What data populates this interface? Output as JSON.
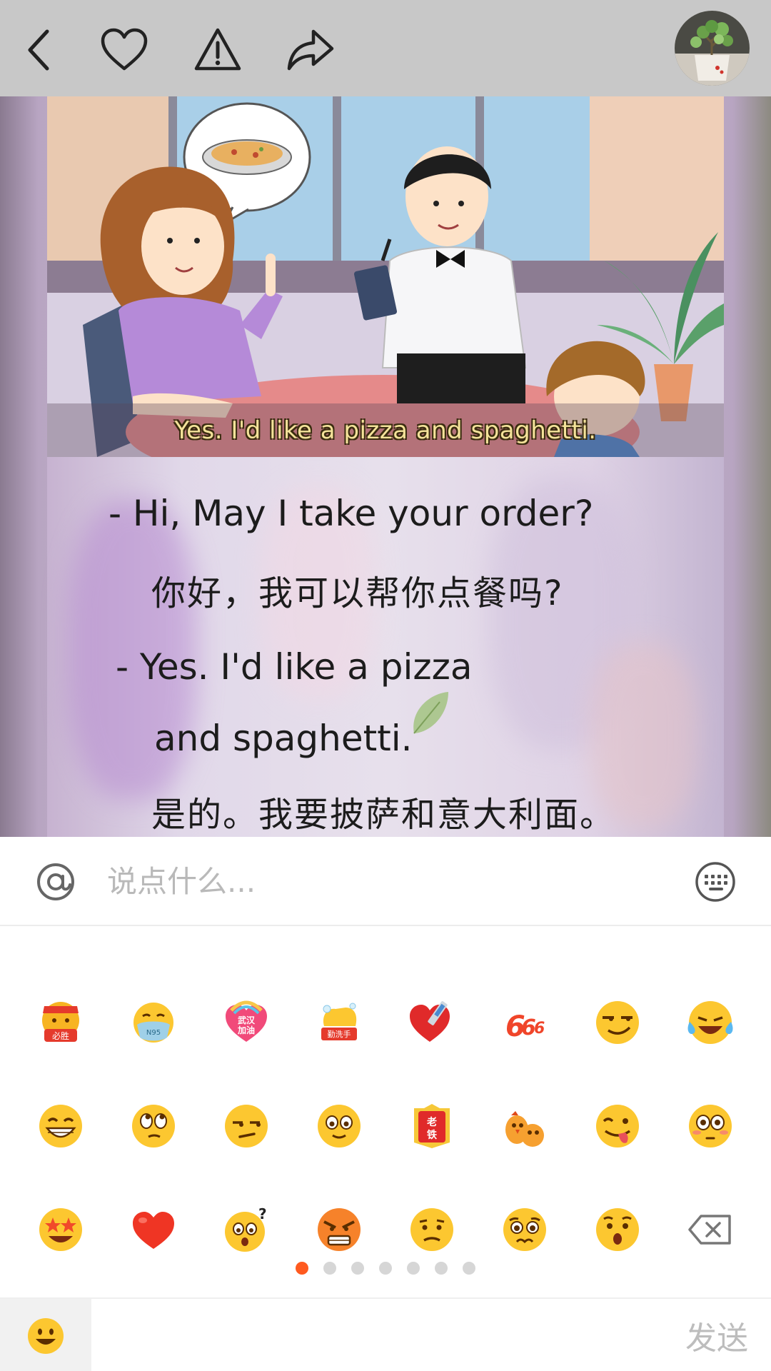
{
  "topbar": {
    "back_icon": "chevron-left-icon",
    "like_icon": "heart-outline-icon",
    "report_icon": "warning-triangle-icon",
    "share_icon": "share-arrow-icon",
    "avatar": "user-avatar-plant"
  },
  "media": {
    "subtitle": "Yes. I'd like a pizza and spaghetti.",
    "lines": [
      "- Hi, May I take your order?",
      "你好，我可以帮你点餐吗?",
      "- Yes. I'd like a pizza",
      "and spaghetti.",
      "是的。我要披萨和意大利面。"
    ]
  },
  "comment": {
    "placeholder": "说点什么...",
    "at_icon": "at-mention-icon",
    "keyboard_icon": "keyboard-icon"
  },
  "emoji_panel": {
    "rows": [
      [
        "bisheng-emoji",
        "mask-n95-emoji",
        "wuhan-jiayou-emoji",
        "wash-hands-emoji",
        "heart-syringe-emoji",
        "666-emoji",
        "smirk-glasses-emoji",
        "laugh-cry-emoji"
      ],
      [
        "grin-emoji",
        "eye-roll-emoji",
        "unamused-emoji",
        "blank-stare-emoji",
        "laotie-emoji",
        "chicks-emoji",
        "tongue-wink-emoji",
        "flushed-emoji"
      ],
      [
        "star-eyes-emoji",
        "red-heart-emoji",
        "confused-question-emoji",
        "angry-emoji",
        "slight-frown-emoji",
        "pleading-emoji",
        "surprised-emoji",
        "backspace-icon"
      ]
    ],
    "page_count": 7,
    "active_page": 1
  },
  "bottom_bar": {
    "emoji_toggle_icon": "smiley-face-icon",
    "send_label": "发送"
  },
  "colors": {
    "topbar_bg": "#c8c8c8",
    "accent": "#ff5a1f",
    "placeholder": "#b9b9b9",
    "send_disabled": "#bdbdbd"
  }
}
